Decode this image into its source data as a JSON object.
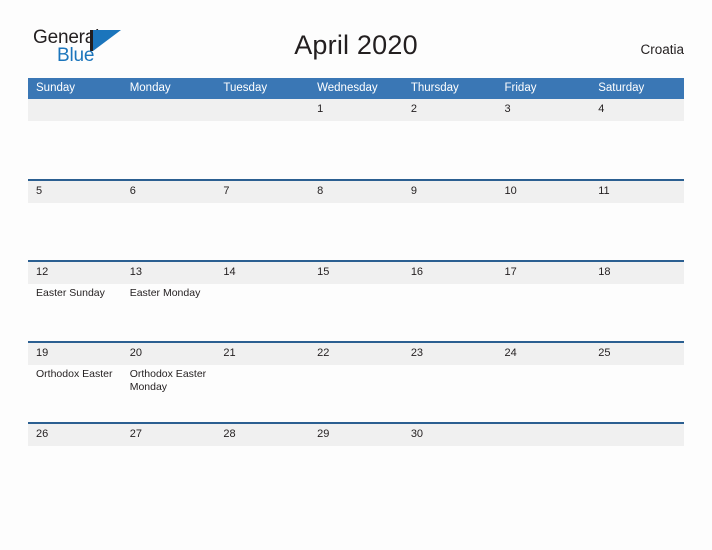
{
  "brand": {
    "name_part1": "General",
    "name_part2": "Blue",
    "logo_icon": "general-blue-triangle-logo"
  },
  "header": {
    "title": "April 2020",
    "location": "Croatia"
  },
  "calendar": {
    "weekday_headers": [
      "Sunday",
      "Monday",
      "Tuesday",
      "Wednesday",
      "Thursday",
      "Friday",
      "Saturday"
    ],
    "weeks": [
      [
        {
          "day": "",
          "events": []
        },
        {
          "day": "",
          "events": []
        },
        {
          "day": "",
          "events": []
        },
        {
          "day": "1",
          "events": []
        },
        {
          "day": "2",
          "events": []
        },
        {
          "day": "3",
          "events": []
        },
        {
          "day": "4",
          "events": []
        }
      ],
      [
        {
          "day": "5",
          "events": []
        },
        {
          "day": "6",
          "events": []
        },
        {
          "day": "7",
          "events": []
        },
        {
          "day": "8",
          "events": []
        },
        {
          "day": "9",
          "events": []
        },
        {
          "day": "10",
          "events": []
        },
        {
          "day": "11",
          "events": []
        }
      ],
      [
        {
          "day": "12",
          "events": [
            "Easter Sunday"
          ]
        },
        {
          "day": "13",
          "events": [
            "Easter Monday"
          ]
        },
        {
          "day": "14",
          "events": []
        },
        {
          "day": "15",
          "events": []
        },
        {
          "day": "16",
          "events": []
        },
        {
          "day": "17",
          "events": []
        },
        {
          "day": "18",
          "events": []
        }
      ],
      [
        {
          "day": "19",
          "events": [
            "Orthodox Easter"
          ]
        },
        {
          "day": "20",
          "events": [
            "Orthodox Easter Monday"
          ]
        },
        {
          "day": "21",
          "events": []
        },
        {
          "day": "22",
          "events": []
        },
        {
          "day": "23",
          "events": []
        },
        {
          "day": "24",
          "events": []
        },
        {
          "day": "25",
          "events": []
        }
      ],
      [
        {
          "day": "26",
          "events": []
        },
        {
          "day": "27",
          "events": []
        },
        {
          "day": "28",
          "events": []
        },
        {
          "day": "29",
          "events": []
        },
        {
          "day": "30",
          "events": []
        },
        {
          "day": "",
          "events": []
        },
        {
          "day": "",
          "events": []
        }
      ]
    ]
  },
  "colors": {
    "header_blue": "#3a77b5",
    "divider_blue": "#2b5f91",
    "daynum_band": "#f0f0f0",
    "brand_blue": "#1b75bc",
    "text": "#231f20"
  }
}
